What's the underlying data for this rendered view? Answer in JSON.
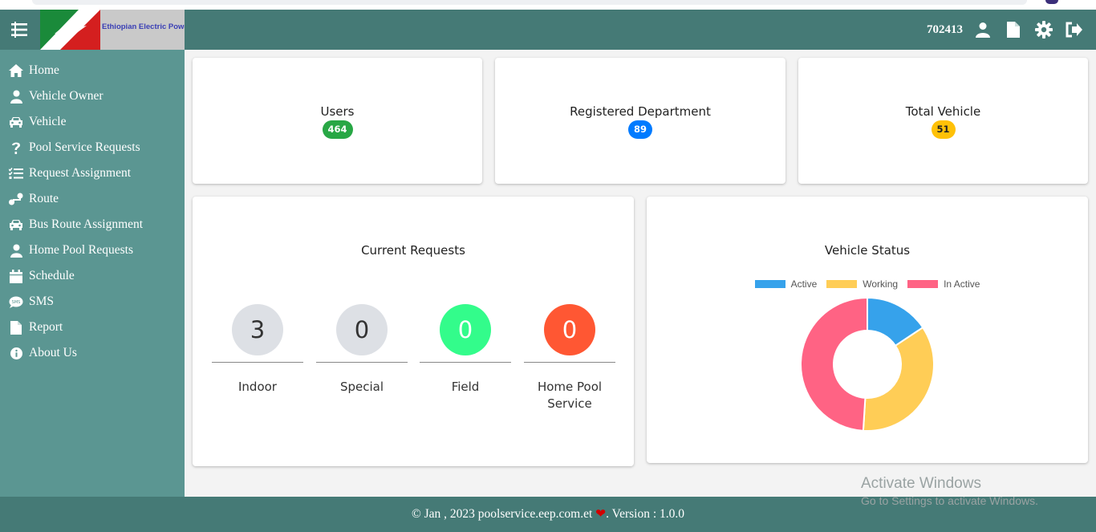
{
  "header": {
    "brand_name": "Ethiopian Electric Power",
    "user_id": "702413",
    "icons": [
      "menu-icon",
      "user-icon",
      "document-icon",
      "gear-icon",
      "logout-icon"
    ]
  },
  "sidebar": {
    "items": [
      {
        "label": "Home",
        "icon": "home-icon"
      },
      {
        "label": "Vehicle Owner",
        "icon": "user-icon"
      },
      {
        "label": "Vehicle",
        "icon": "car-icon"
      },
      {
        "label": "Pool Service Requests",
        "icon": "question-icon"
      },
      {
        "label": "Request Assignment",
        "icon": "tasks-icon"
      },
      {
        "label": "Route",
        "icon": "route-icon"
      },
      {
        "label": "Bus Route Assignment",
        "icon": "car-icon"
      },
      {
        "label": "Home Pool Requests",
        "icon": "user-icon"
      },
      {
        "label": "Schedule",
        "icon": "calendar-icon"
      },
      {
        "label": "SMS",
        "icon": "sms-icon"
      },
      {
        "label": "Report",
        "icon": "file-icon"
      },
      {
        "label": "About Us",
        "icon": "info-icon"
      }
    ]
  },
  "stats": [
    {
      "title": "Users",
      "value": "464",
      "color": "#28a745",
      "text_color": "#ffffff"
    },
    {
      "title": "Registered Department",
      "value": "89",
      "color": "#007bff",
      "text_color": "#ffffff"
    },
    {
      "title": "Total Vehicle",
      "value": "51",
      "color": "#ffc107",
      "text_color": "#222222"
    }
  ],
  "current_requests": {
    "title": "Current Requests",
    "items": [
      {
        "value": "3",
        "label": "Indoor",
        "color": "#dde0e5",
        "text_color": "#333333"
      },
      {
        "value": "0",
        "label": "Special",
        "color": "#dde0e5",
        "text_color": "#333333"
      },
      {
        "value": "0",
        "label": "Field",
        "color": "#33fc8b",
        "text_color": "#ffffff"
      },
      {
        "value": "0",
        "label": "Home Pool Service",
        "color": "#ff5733",
        "text_color": "#ffffff"
      }
    ]
  },
  "vehicle_status": {
    "title": "Vehicle Status"
  },
  "chart_data": {
    "type": "pie",
    "variant": "doughnut",
    "title": "Vehicle Status",
    "legend_position": "top",
    "categories": [
      "Active",
      "Working",
      "In Active"
    ],
    "values": [
      8,
      18,
      25
    ],
    "colors": [
      "#36a2eb",
      "#ffcd56",
      "#ff6384"
    ]
  },
  "footer": {
    "prefix": "© Jan , 2023 poolservice.eep.com.et ",
    "heart": "❤",
    "suffix": ". Version : 1.0.0"
  },
  "watermark": {
    "line1": "Activate Windows",
    "line2": "Go to Settings to activate Windows."
  }
}
